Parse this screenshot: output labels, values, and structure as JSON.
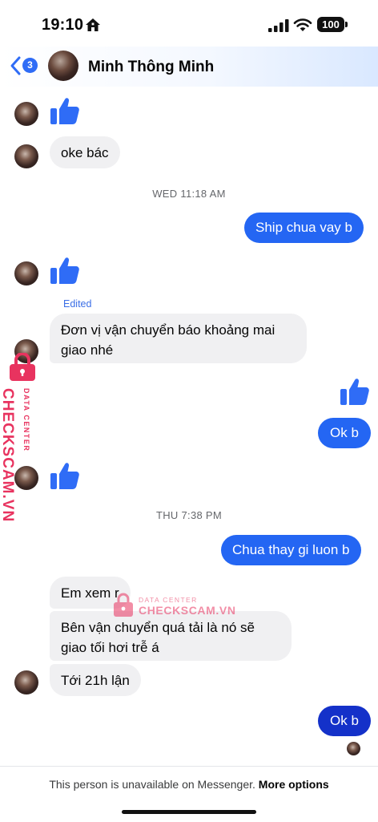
{
  "status_bar": {
    "time": "19:10",
    "battery": "100",
    "icons": [
      "home-icon",
      "signal-icon",
      "wifi-icon",
      "battery-icon"
    ]
  },
  "header": {
    "back_badge": "3",
    "contact_name": "Minh Thông Minh",
    "icons": [
      "back-chevron-icon",
      "avatar"
    ]
  },
  "colors": {
    "outgoing_bubble": "#2466f3",
    "outgoing_bubble_last": "#1431c9",
    "incoming_bubble": "#f0f0f2",
    "like_icon": "#2f6cf6",
    "watermark": "#e8335f"
  },
  "messages": {
    "m1": {
      "type": "like",
      "direction": "in"
    },
    "m2": {
      "text": "oke bác",
      "direction": "in"
    },
    "day1": "WED 11:18 AM",
    "m3": {
      "text": "Ship chua vay b",
      "direction": "out"
    },
    "m4": {
      "type": "like",
      "direction": "in"
    },
    "edited_label": "Edited",
    "m5": {
      "text": "Đơn vị vận chuyển báo khoảng mai giao nhé",
      "direction": "in"
    },
    "m6": {
      "type": "like",
      "direction": "out"
    },
    "m7": {
      "text": "Ok b",
      "direction": "out"
    },
    "m8": {
      "type": "like",
      "direction": "in"
    },
    "day2": "THU 7:38 PM",
    "m9": {
      "text": "Chua thay gi luon b",
      "direction": "out"
    },
    "m10": {
      "text": "Em xem r",
      "direction": "in"
    },
    "m11": {
      "text": "Bên vận chuyển quá tải là nó sẽ giao tối hơi trễ á",
      "direction": "in"
    },
    "m12": {
      "text": "Tới 21h lận",
      "direction": "in"
    },
    "m13": {
      "text": "Ok b",
      "direction": "out"
    }
  },
  "footer": {
    "text": "This person is unavailable on Messenger.",
    "link": "More options"
  },
  "watermark": {
    "brand": "CHECKSCAM.VN",
    "subtitle": "DATA CENTER"
  }
}
